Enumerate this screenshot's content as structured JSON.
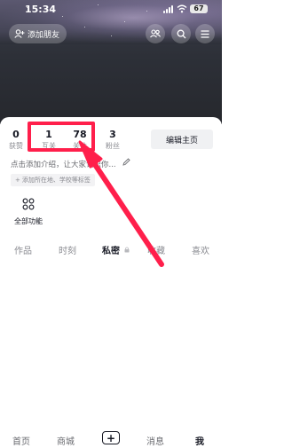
{
  "status_bar": {
    "time": "15:34",
    "battery": "67"
  },
  "header": {
    "add_friend_label": "添加朋友",
    "icons": [
      "friends-icon",
      "search-icon",
      "menu-icon"
    ]
  },
  "profile": {
    "stats": [
      {
        "value": "0",
        "label": "获赞"
      },
      {
        "value": "1",
        "label": "互关"
      },
      {
        "value": "78",
        "label": "关注"
      },
      {
        "value": "3",
        "label": "粉丝"
      }
    ],
    "edit_button": "编辑主页",
    "bio_placeholder": "点击添加介绍，让大家认识你...",
    "location_tag": "添加所在地、学校等标签",
    "all_functions": "全部功能"
  },
  "tabs": [
    {
      "label": "作品",
      "active": false
    },
    {
      "label": "时刻",
      "active": false
    },
    {
      "label": "私密",
      "active": true
    },
    {
      "label": "收藏",
      "active": false
    },
    {
      "label": "喜欢",
      "active": false
    }
  ],
  "bottom_nav": [
    {
      "label": "首页",
      "active": false
    },
    {
      "label": "商城",
      "active": false
    },
    {
      "label": "+",
      "active": false
    },
    {
      "label": "消息",
      "active": false
    },
    {
      "label": "我",
      "active": true
    }
  ],
  "colors": {
    "annotation": "#ff1f4b",
    "banner": "#2d3038",
    "edit_button_bg": "#f0f1f3"
  }
}
